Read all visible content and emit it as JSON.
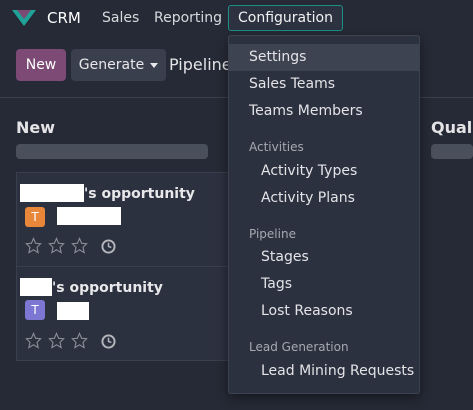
{
  "navbar": {
    "app_name": "CRM",
    "items": [
      "Sales",
      "Reporting",
      "Configuration"
    ]
  },
  "controls": {
    "new_label": "New",
    "generate_label": "Generate",
    "breadcrumb": "Pipeline"
  },
  "columns": [
    {
      "title": "New"
    },
    {
      "title": "Quali"
    }
  ],
  "cards": [
    {
      "title_suffix": "'s opportunity",
      "avatar_letter": "T",
      "avatar_color": "#E8863A"
    },
    {
      "title_suffix": "'s opportunity",
      "avatar_letter": "T",
      "avatar_color": "#7D77D4"
    }
  ],
  "dropdown": {
    "items": {
      "settings": "Settings",
      "sales_teams": "Sales Teams",
      "teams_members": "Teams Members",
      "activities_header": "Activities",
      "activity_types": "Activity Types",
      "activity_plans": "Activity Plans",
      "pipeline_header": "Pipeline",
      "stages": "Stages",
      "tags": "Tags",
      "lost_reasons": "Lost Reasons",
      "lead_gen_header": "Lead Generation",
      "lead_mining": "Lead Mining Requests"
    }
  },
  "colors": {
    "background": "#262A36",
    "primary": "#7C4A74",
    "config_border": "#1E8F85"
  }
}
